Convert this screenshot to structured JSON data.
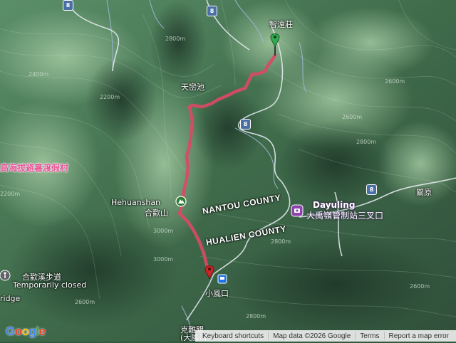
{
  "map": {
    "labels": {
      "zhiyuanzhuang": "智遠莊",
      "tianluanchi": "天巒池",
      "hehuanshan_en": "Hehuanshan",
      "hehuanshan_zh": "合歡山",
      "xiaofengkou": "小風口",
      "kuifengkou": "克難關",
      "dayufeng": "(大風口",
      "resort": "高海拔避暑渡假村",
      "hehuan_trail": "合歡溪步道",
      "temporarily_closed": "Temporarily closed",
      "ridge": "ridge",
      "dayuling_en": "Dayuling",
      "dayuling_zh": "大禹嶺管制站三叉口",
      "guanyuan": "關原"
    },
    "counties": {
      "nantou": "NANTOU COUNTY",
      "hualien": "HUALIEN COUNTY"
    },
    "routes": [
      "8",
      "8",
      "8",
      "8"
    ],
    "elevations": [
      "2800m",
      "2200m",
      "2600m",
      "2800m",
      "2600m",
      "2200m",
      "2400m",
      "2600m",
      "3000m",
      "2800m",
      "3000m",
      "2600m",
      "2800m"
    ],
    "colors": {
      "track": "#e0506a",
      "start_marker": "#34a853",
      "end_marker": "#c62828",
      "poi_pink": "#e8559a",
      "poi_purple": "#8e44ad"
    }
  },
  "footer": {
    "keyboard": "Keyboard shortcuts",
    "map_data": "Map data ©2026 Google",
    "terms": "Terms",
    "report": "Report a map error"
  },
  "logo": "Google"
}
